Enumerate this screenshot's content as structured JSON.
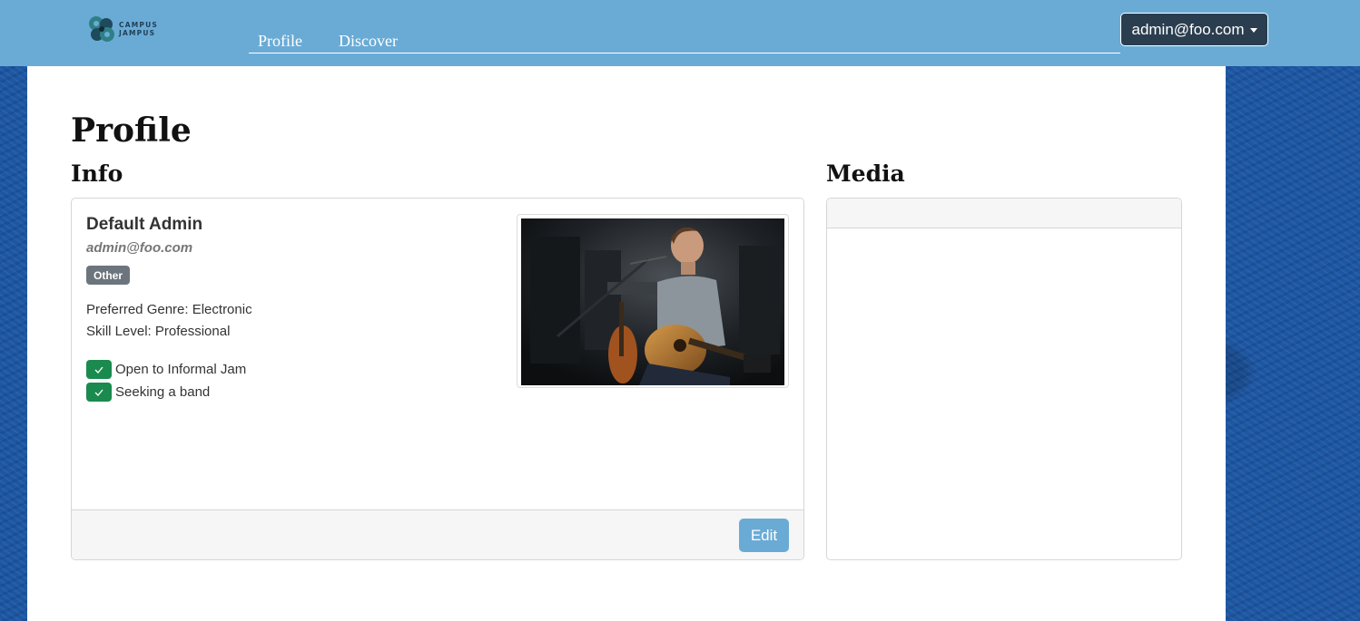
{
  "brand": {
    "logo_line1": "CAMPUS",
    "logo_line2": "JAMPUS"
  },
  "nav": {
    "links": [
      {
        "label": "Profile"
      },
      {
        "label": "Discover"
      }
    ],
    "user_menu_label": "admin@foo.com"
  },
  "page": {
    "title": "Profile"
  },
  "info": {
    "heading": "Info",
    "name": "Default Admin",
    "email": "admin@foo.com",
    "badge": "Other",
    "preferred_genre": "Preferred Genre: Electronic",
    "skill_level": "Skill Level: Professional",
    "checks": [
      {
        "label": "Open to Informal Jam",
        "checked": true
      },
      {
        "label": "Seeking a band",
        "checked": true
      }
    ],
    "edit_label": "Edit"
  },
  "media": {
    "heading": "Media"
  },
  "colors": {
    "navbar": "#6aabd6",
    "user_button": "#2b3e4f",
    "check_green": "#1a8a4f",
    "badge_gray": "#6c757d",
    "edit_button": "#6aabd6"
  }
}
